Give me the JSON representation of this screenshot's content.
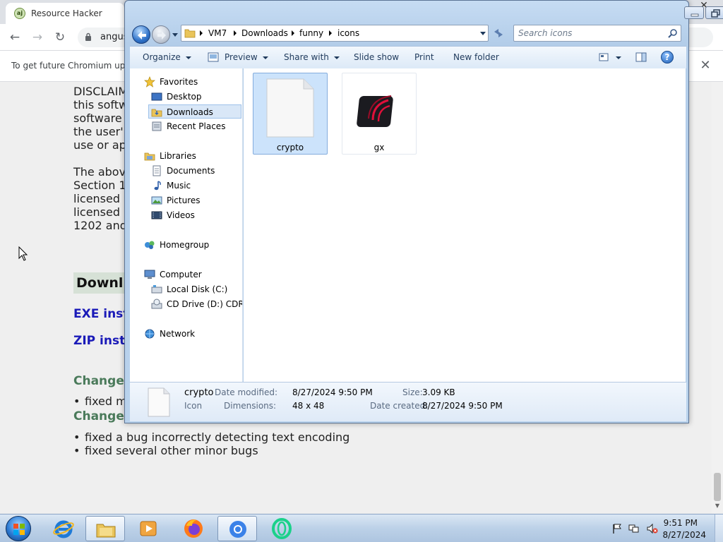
{
  "browser": {
    "tab_title": "Resource Hacker",
    "favicon_text": "aj",
    "url": "angus",
    "infobar_text": "To get future Chromium upc",
    "page": {
      "disclaimer_lines": [
        "DISCLAIM",
        "this softw",
        "software",
        "the user'",
        "use or ap"
      ],
      "para2_lines": [
        "The abov",
        "Section 1",
        "licensed",
        "licensed",
        "1202 and"
      ],
      "download_heading": "Downl",
      "exe_link": "EXE inst",
      "zip_link": "ZIP insta",
      "changes_heading_1": "Changes",
      "bullet_1": "fixed m",
      "changes_heading_2": "Changes",
      "bullet_2": "fixed a bug incorrectly detecting text encoding",
      "bullet_3": "fixed several other minor bugs"
    }
  },
  "explorer": {
    "breadcrumb": [
      "VM7",
      "Downloads",
      "funny",
      "icons"
    ],
    "search_placeholder": "Search icons",
    "commands": {
      "organize": "Organize",
      "preview": "Preview",
      "share_with": "Share with",
      "slide_show": "Slide show",
      "print": "Print",
      "new_folder": "New folder"
    },
    "nav": {
      "favorites": "Favorites",
      "desktop": "Desktop",
      "downloads": "Downloads",
      "recent_places": "Recent Places",
      "libraries": "Libraries",
      "documents": "Documents",
      "music": "Music",
      "pictures": "Pictures",
      "videos": "Videos",
      "homegroup": "Homegroup",
      "computer": "Computer",
      "local_disk": "Local Disk (C:)",
      "cd_drive": "CD Drive (D:) CDROI",
      "network": "Network"
    },
    "files": [
      {
        "name": "crypto",
        "selected": true
      },
      {
        "name": "gx",
        "selected": false
      }
    ],
    "details": {
      "name": "crypto",
      "type": "Icon",
      "date_modified_label": "Date modified:",
      "date_modified": "8/27/2024 9:50 PM",
      "dimensions_label": "Dimensions:",
      "dimensions": "48 x 48",
      "size_label": "Size:",
      "size": "3.09 KB",
      "date_created_label": "Date created:",
      "date_created": "8/27/2024 9:50 PM"
    },
    "help_glyph": "?"
  },
  "taskbar": {
    "time": "9:51 PM",
    "date": "8/27/2024"
  },
  "colors": {
    "accent_link": "#1a1ab8",
    "selection": "#cce3fb",
    "gx_red": "#e0103a"
  }
}
